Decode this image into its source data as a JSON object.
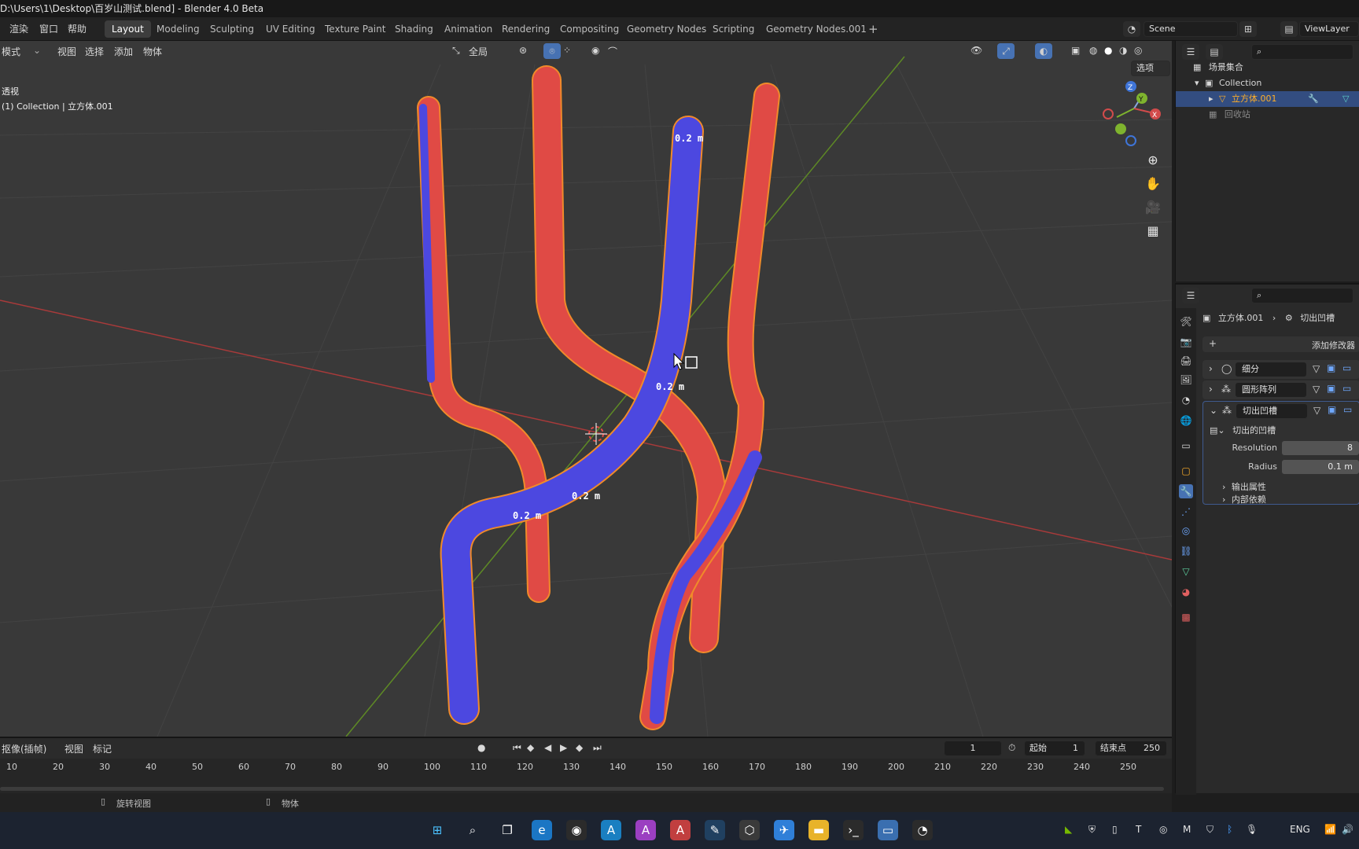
{
  "window": {
    "title": "D:\\Users\\1\\Desktop\\百岁山测试.blend] - Blender 4.0 Beta"
  },
  "top_menu": [
    "渲染",
    "窗口",
    "帮助"
  ],
  "workspaces": [
    {
      "label": "Layout",
      "active": true
    },
    {
      "label": "Modeling",
      "active": false
    },
    {
      "label": "Sculpting",
      "active": false
    },
    {
      "label": "UV Editing",
      "active": false
    },
    {
      "label": "Texture Paint",
      "active": false
    },
    {
      "label": "Shading",
      "active": false
    },
    {
      "label": "Animation",
      "active": false
    },
    {
      "label": "Rendering",
      "active": false
    },
    {
      "label": "Compositing",
      "active": false
    },
    {
      "label": "Geometry Nodes",
      "active": false
    },
    {
      "label": "Scripting",
      "active": false
    },
    {
      "label": "Geometry Nodes.001",
      "active": false
    }
  ],
  "add_workspace": "+",
  "scene": {
    "label": "Scene"
  },
  "view_layer": {
    "label": "ViewLayer"
  },
  "viewport": {
    "mode": "模式",
    "menus": [
      "视图",
      "选择",
      "添加",
      "物体"
    ],
    "transform_orientation": "全局",
    "options_label": "选项",
    "view_name": "透视",
    "collection_info": "(1) Collection | 立方体.001",
    "measurements": [
      "0.2 m",
      "0.2 m",
      "0.2 m",
      "0.2 m"
    ]
  },
  "timeline": {
    "menus": [
      "抠像(插帧)",
      "视图",
      "标记"
    ],
    "current_frame": "1",
    "start_label": "起始",
    "start_value": "1",
    "end_label": "结束点",
    "end_value": "250",
    "ruler": [
      "10",
      "20",
      "30",
      "40",
      "50",
      "60",
      "70",
      "80",
      "90",
      "100",
      "110",
      "120",
      "130",
      "140",
      "150",
      "160",
      "170",
      "180",
      "190",
      "200",
      "210",
      "220",
      "230",
      "240",
      "250"
    ]
  },
  "status": {
    "left_hint": "旋转视图",
    "right_hint": "物体"
  },
  "outliner": {
    "root": "场景集合",
    "collection": "Collection",
    "object": "立方体.001",
    "trash": "回收站"
  },
  "properties": {
    "breadcrumb_object": "立方体.001",
    "breadcrumb_modifier": "切出凹槽",
    "add_modifier": "添加修改器",
    "modifiers": [
      "细分",
      "圆形阵列",
      "切出凹槽"
    ],
    "node_group": "切出的凹槽",
    "fields": [
      {
        "label": "Resolution",
        "value": "8"
      },
      {
        "label": "Radius",
        "value": "0.1 m"
      }
    ],
    "panels": [
      "输出属性",
      "内部依赖"
    ]
  },
  "taskbar": {
    "lang": "ENG"
  },
  "colors": {
    "accent": "#4772b3",
    "active_object": "#ffaf29",
    "tube_red": "#e04a45",
    "tube_blue": "#4c48e0",
    "x_axis": "#c43b3b",
    "y_axis": "#6b9a27"
  }
}
